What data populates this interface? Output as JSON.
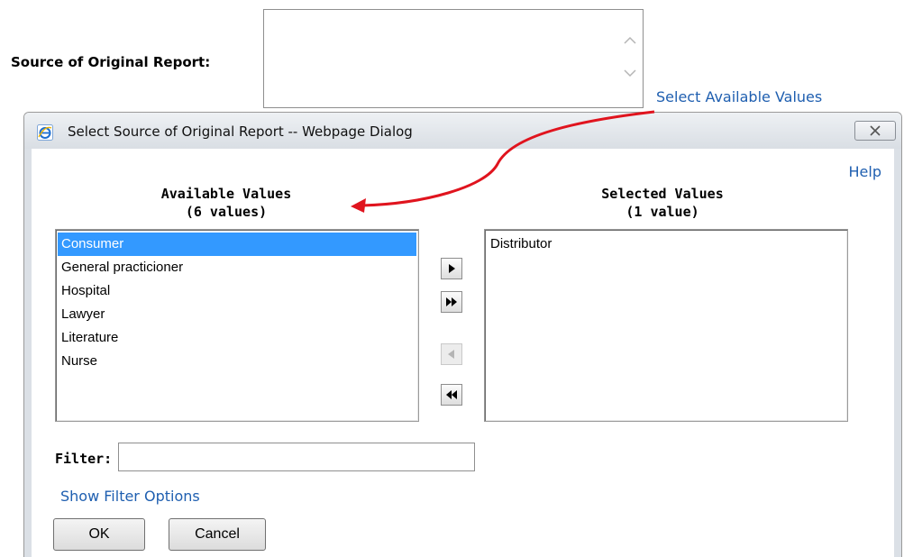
{
  "form": {
    "source_label": "Source of Original Report:",
    "source_value": "",
    "select_link": "Select Available Values"
  },
  "dialog": {
    "title": "Select Source of Original Report -- Webpage Dialog",
    "help_link": "Help",
    "available": {
      "heading": "Available Values",
      "count": "(6 values)",
      "items": [
        "Consumer",
        "General practicioner",
        "Hospital",
        "Lawyer",
        "Literature",
        "Nurse"
      ],
      "selected_item": "Consumer"
    },
    "selected": {
      "heading": "Selected Values",
      "count": "(1 value)",
      "items": [
        "Distributor"
      ]
    },
    "move_buttons": {
      "add": "right-arrow-icon",
      "add_all": "double-right-arrow-icon",
      "remove": "left-arrow-icon",
      "remove_all": "double-left-arrow-icon"
    },
    "filter": {
      "label": "Filter:",
      "value": "",
      "show_options_link": "Show Filter Options"
    },
    "buttons": {
      "ok": "OK",
      "cancel": "Cancel"
    }
  },
  "colors": {
    "link": "#1f5fb0",
    "selection": "#3399ff",
    "annotation_arrow": "#e0141e"
  }
}
